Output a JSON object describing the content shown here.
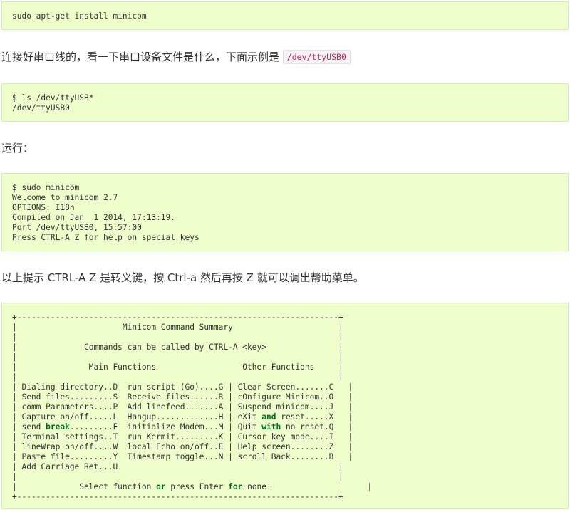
{
  "blocks": {
    "install": {
      "lines": [
        "sudo apt-get install minicom"
      ]
    },
    "para1": {
      "text": "连接好串口线的，看一下串口设备文件是什么，下面示例是 ",
      "code": "/dev/ttyUSB0"
    },
    "ls": {
      "lines": [
        "$ ls /dev/ttyUSB*",
        "/dev/ttyUSB0"
      ]
    },
    "para2": {
      "text": "运行："
    },
    "run": {
      "lines": [
        "$ sudo minicom",
        "Welcome to minicom 2.7",
        "OPTIONS: I18n",
        "Compiled on Jan  1 2014, 17:13:19.",
        "Port /dev/ttyUSB0, 15:57:00",
        "Press CTRL-A Z for help on special keys"
      ]
    },
    "para3": {
      "text": "以上提示 CTRL-A Z 是转义键，按 Ctrl-a 然后再按 Z 就可以调出帮助菜单。"
    },
    "summary": {
      "border": "+-------------------------------------------------------------------+",
      "blank": "|                                                                   |",
      "title": "|                      Minicom Command Summary                      |",
      "commands": "|              Commands can be called by CTRL-A <key>               |",
      "headers": "|               Main Functions                  Other Functions     |",
      "rows": [
        {
          "pre": "| Dialing directory..D  run script (Go)....G | Clear Screen.......C   |"
        },
        {
          "pre": "| Send files.........S  Receive files......R | cOnfigure Minicom..O   |"
        },
        {
          "pre": "| comm Parameters....P  Add linefeed.......A | Suspend minicom....J   |"
        },
        {
          "pre": "| Capture on/off.....L  Hangup.............H | eXit ",
          "kw": "and",
          "post": " reset.....X   |"
        },
        {
          "pre": "| send ",
          "kw": "break",
          "post": ".........F  initialize Modem...M | Quit ",
          "kw2": "with",
          "post2": " no reset.Q   |"
        },
        {
          "pre": "| Terminal settings..T  run Kermit.........K | Cursor key mode....I   |"
        },
        {
          "pre": "| lineWrap on/off....W  local Echo on/off..E | Help screen........Z   |"
        },
        {
          "pre": "| Paste file.........Y  Timestamp toggle...N | scroll Back........B   |"
        },
        {
          "pre": "| Add Carriage Ret...U                                              |"
        }
      ],
      "footer_pre": "|             Select function ",
      "footer_kw1": "or",
      "footer_mid": " press Enter ",
      "footer_kw2": "for",
      "footer_post": " none.                    |"
    }
  }
}
